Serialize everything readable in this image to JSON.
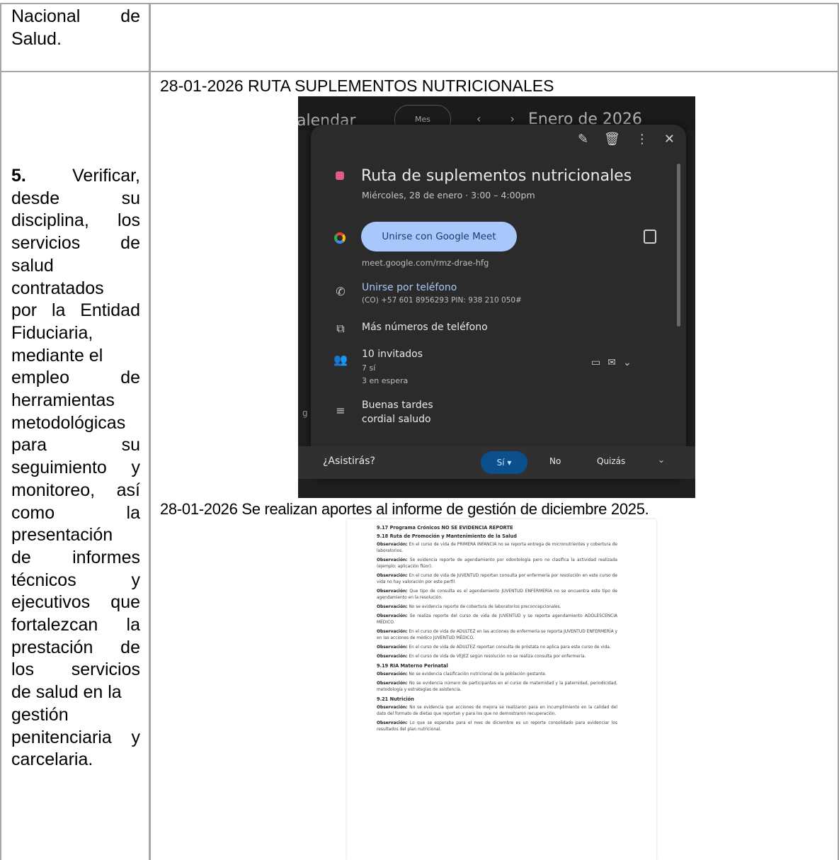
{
  "table": {
    "left_col_prev": [
      "Nacional",
      "de",
      "Salud."
    ],
    "item_number": "5.",
    "item_lines": [
      "Verificar,",
      "desde su",
      "disciplina, los",
      "servicios de",
      "salud",
      "contratados",
      "por la Entidad",
      "Fiduciaria,",
      "mediante el",
      "empleo de",
      "herramientas",
      "metodológicas",
      "para su",
      "seguimiento y",
      "monitoreo, así",
      "como la",
      "presentación",
      "de informes",
      "técnicos y",
      "ejecutivos que",
      "fortalezcan la",
      "prestación de",
      "los servicios",
      "de salud en la",
      "gestión",
      "penitenciaria y",
      "carcelaria."
    ],
    "caption_1": "28-01-2026 RUTA SUPLEMENTOS NUTRICIONALES",
    "caption_2": "28-01-2026 Se realizan aportes al informe de gestión de diciembre  2025."
  },
  "calendar": {
    "bg_title": "alendar",
    "bg_view": "Mes",
    "bg_nav": "‹ ›",
    "bg_month": "Enero de 2026",
    "actions": [
      "edit-icon",
      "delete-icon",
      "more-icon",
      "close-icon"
    ],
    "event_title": "Ruta de suplementos nutricionales",
    "event_date": "Miércoles, 28 de enero · 3:00 – 4:00pm",
    "meet_button": "Unirse con Google Meet",
    "meet_link": "meet.google.com/rmz-drae-hfg",
    "phone_title": "Unirse por teléfono",
    "phone_number": "(CO) +57 601 8956293 PIN: 938 210 050#",
    "more_numbers": "Más números de teléfono",
    "guests_title": "10 invitados",
    "guests_yes": "7 sí",
    "guests_waiting": "3 en espera",
    "description_line1": "Buenas tardes",
    "description_line2": "cordial saludo",
    "rsvp_question": "¿Asistirás?",
    "rsvp_yes": "Sí",
    "rsvp_no": "No",
    "rsvp_maybe": "Quizás",
    "colors": {
      "event": "#e25b82",
      "meet_button": "#a8c7fa",
      "rsvp_selected": "#0b4f8c"
    }
  },
  "report": {
    "head1": "9.17 Programa Crónicos NO SE EVIDENCIA REPORTE",
    "head2": "9.18 Ruta de Promoción y Mantenimiento de la Salud",
    "obs_label": "Observación:",
    "paras_1": [
      "En el curso de vida de PRIMERA INFANCIA no se reporta entrega de micronutrientes y cobertura de laboratorios.",
      "Se evidencia reporte de agendamiento por odontología pero no clasifica la actividad realizada (ejemplo: aplicación flúor).",
      "En el curso de vida de JUVENTUD reportan consulta por enfermería por resolución en este curso de vida no hay valoración por este perfil.",
      "Que tipo de consulta es el agendamiento JUVENTUD ENFERMERÍA no se encuentra este tipo de agendamiento en la resolución.",
      "No se evidencia reporte de cobertura de laboratorios preconcepcionales.",
      "Se realiza reporte del curso de vida de JUVENTUD y se reporta agendamiento ADOLESCENCIA MÉDICO.",
      "En el curso de vida de ADULTEZ en las acciones de enfermería se reporta JUVENTUD ENFERMERÍA y en las acciones de médico JUVENTUD MÉDICO.",
      "En el curso de vida de ADULTEZ reportan consulta de próstata no aplica para este curso de vida.",
      "En el curso de vida de VEJEZ según resolución no se realiza consulta por enfermería."
    ],
    "head3": "9.19 RIA Materno Perinatal",
    "paras_2": [
      "No se evidencia clasificación nutricional de la población gestante.",
      "No se evidencia número de participantes en el curso de maternidad y la paternidad, periodicidad, metodología y estrategias de asistencia."
    ],
    "head4": "9.21 Nutrición",
    "paras_3": [
      "No se evidencia que acciones de mejora se realizaron para en incumplimiento en la calidad del dato del formato de dietas que reportan y para los que no demostraron recuperación.",
      "Lo que se esperaba para el mes de diciembre es un reporte consolidado para evidenciar los resultados del plan nutricional."
    ]
  }
}
